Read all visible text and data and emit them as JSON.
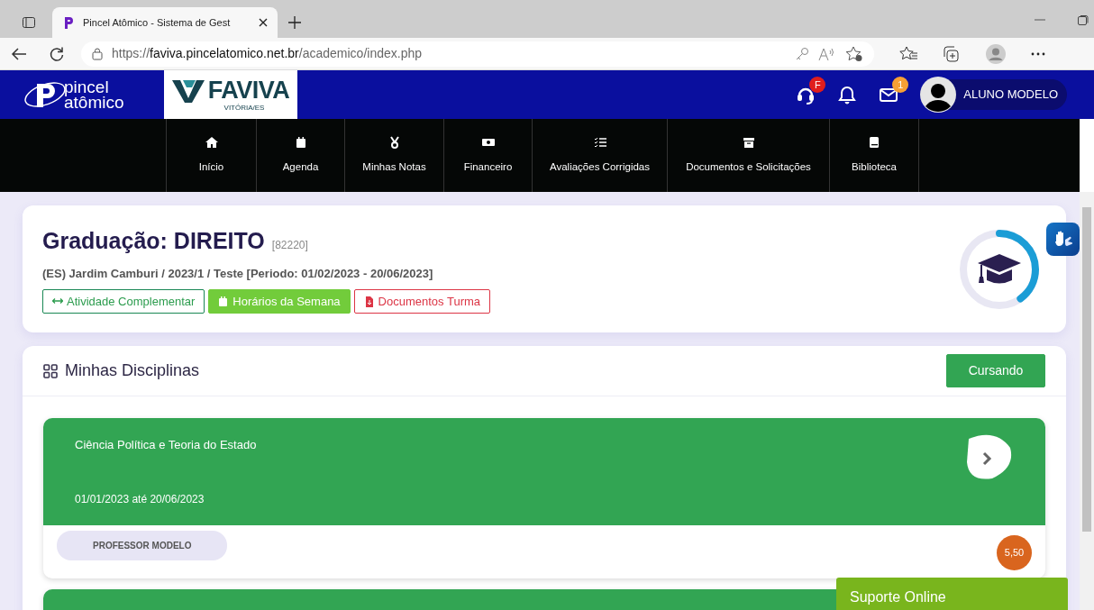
{
  "browser": {
    "tab_title": "Pincel Atômico - Sistema de Gest",
    "url_scheme": "https://",
    "url_host": "faviva.pincelatomico.net.br",
    "url_path": "/academico/index.php"
  },
  "header": {
    "brand_lines": [
      "pincel",
      "atômico"
    ],
    "partner_name": "FAVIVA",
    "partner_place": "VITÓRIA/ES",
    "support_badge": "F",
    "mail_badge": "1",
    "user_name": "ALUNO MODELO"
  },
  "nav": [
    {
      "kind": "home",
      "label": "Início"
    },
    {
      "kind": "calendar",
      "label": "Agenda"
    },
    {
      "kind": "medal",
      "label": "Minhas Notas"
    },
    {
      "kind": "money",
      "label": "Financeiro"
    },
    {
      "kind": "checklist",
      "label": "Avaliações Corrigidas"
    },
    {
      "kind": "archive",
      "label": "Documentos e Solicitações"
    },
    {
      "kind": "book",
      "label": "Biblioteca"
    }
  ],
  "course": {
    "title": "Graduação: DIREITO",
    "code": "[82220]",
    "details": "(ES) Jardim Camburi / 2023/1 / Teste [Periodo: 01/02/2023 - 20/06/2023]",
    "level": 0.4,
    "buttons": [
      {
        "kind": "outline-success",
        "label": "Atividade Complementar"
      },
      {
        "kind": "success",
        "label": "Horários da Semana"
      },
      {
        "kind": "outline-danger",
        "label": "Documentos Turma"
      }
    ]
  },
  "disciplines": {
    "title": "Minhas Disciplinas",
    "status_button": "Cursando",
    "cards": [
      {
        "name": "Ciência Política e Teoria do Estado",
        "period": "01/01/2023 até 20/06/2023",
        "professor": "PROFESSOR MODELO",
        "grade": "5,50"
      },
      {
        "cut_off": true
      }
    ]
  },
  "support_chat": "Suporte Online"
}
